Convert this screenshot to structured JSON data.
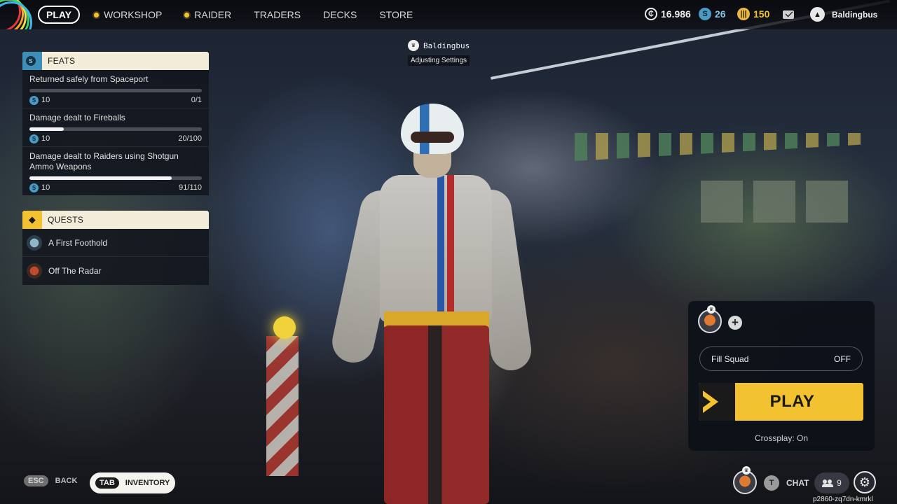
{
  "nav": {
    "play": "PLAY",
    "items": [
      "WORKSHOP",
      "RAIDER",
      "TRADERS",
      "DECKS",
      "STORE"
    ]
  },
  "currencies": {
    "creds": "16.986",
    "tokens": "26",
    "gold": "150"
  },
  "profile": {
    "name": "Baldingbus"
  },
  "status": {
    "name": "Baldingbus",
    "activity": "Adjusting Settings"
  },
  "feats": {
    "header": "FEATS",
    "items": [
      {
        "title": "Returned safely from Spaceport",
        "reward": "10",
        "progress": "0/1",
        "fraction": 0.0
      },
      {
        "title": "Damage dealt to Fireballs",
        "reward": "10",
        "progress": "20/100",
        "fraction": 0.2
      },
      {
        "title": "Damage dealt to Raiders using Shotgun Ammo Weapons",
        "reward": "10",
        "progress": "91/110",
        "fraction": 0.827
      }
    ]
  },
  "quests": {
    "header": "QUESTS",
    "items": [
      "A First Foothold",
      "Off The Radar"
    ]
  },
  "squad": {
    "fill_label": "Fill Squad",
    "fill_value": "OFF",
    "play_label": "PLAY",
    "crossplay": "Crossplay: On"
  },
  "bottom": {
    "esc_key": "ESC",
    "back": "BACK",
    "tab_key": "TAB",
    "inventory": "INVENTORY",
    "chat_key": "T",
    "chat": "CHAT",
    "friends_count": "9",
    "session_id": "p2860-zq7dn-kmrkl"
  },
  "colors": {
    "accent": "#f2c230",
    "token": "#4a9bc4",
    "panel_header": "#f2ecd8"
  }
}
